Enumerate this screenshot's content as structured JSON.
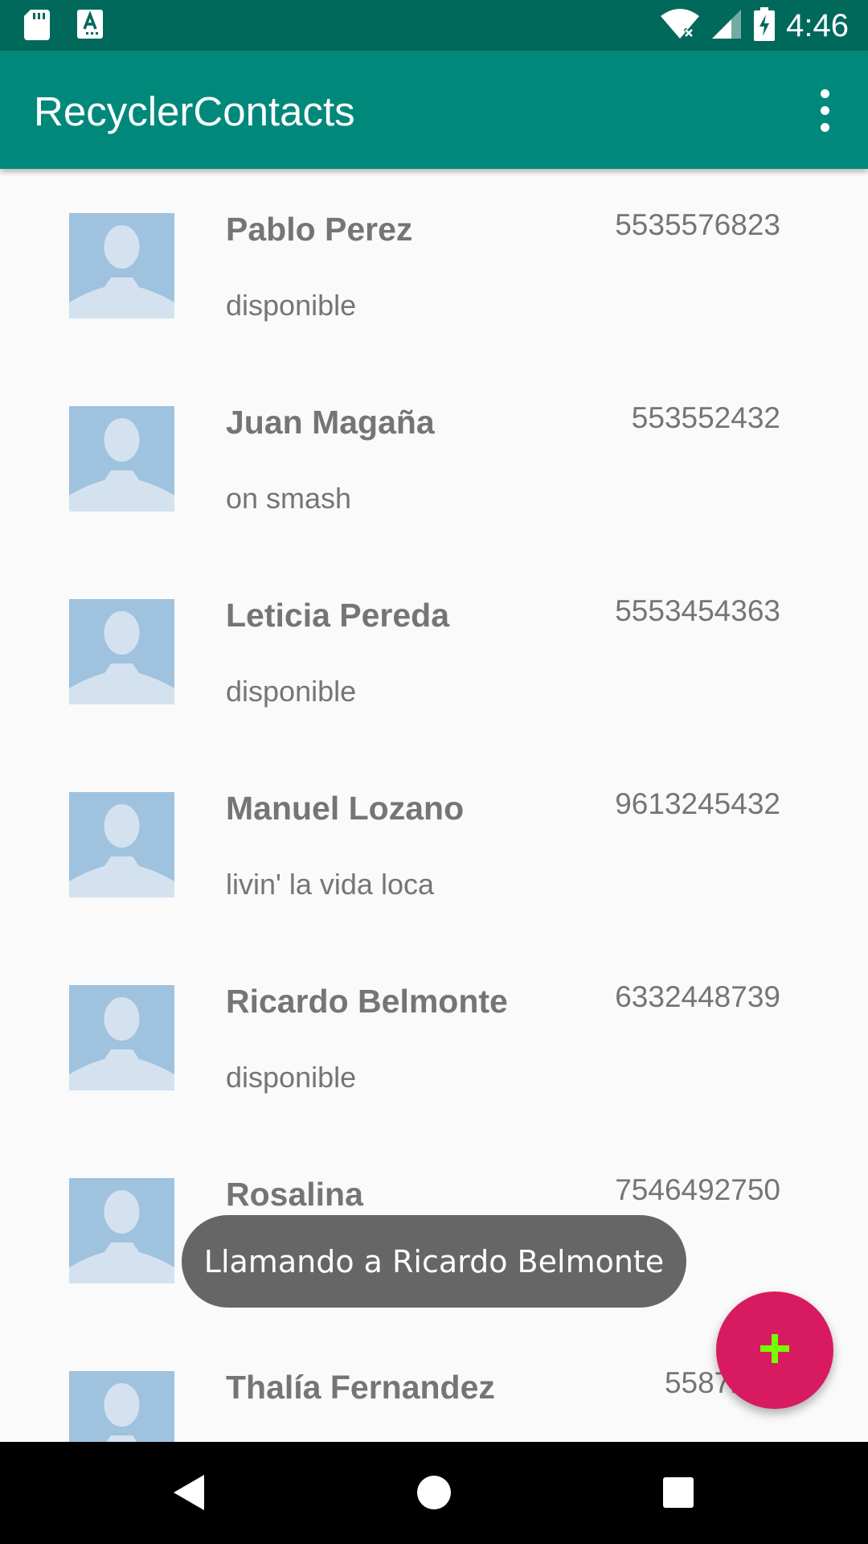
{
  "status_bar": {
    "time": "4:46",
    "icons_left": [
      "sd-card-icon",
      "text-a-icon"
    ],
    "icons_right": [
      "wifi-icon",
      "cell-signal-icon",
      "battery-charging-icon"
    ]
  },
  "app_bar": {
    "title": "RecyclerContacts",
    "menu_icon": "more-vert-icon",
    "color": "#00897b",
    "status_color": "#00695c"
  },
  "contacts": [
    {
      "name": "Pablo Perez",
      "status": "disponible",
      "phone": "5535576823"
    },
    {
      "name": "Juan Magaña",
      "status": "on smash",
      "phone": "553552432"
    },
    {
      "name": "Leticia Pereda",
      "status": "disponible",
      "phone": "5553454363"
    },
    {
      "name": "Manuel Lozano",
      "status": "livin' la vida loca",
      "phone": "9613245432"
    },
    {
      "name": "Ricardo Belmonte",
      "status": "disponible",
      "phone": "6332448739"
    },
    {
      "name": "Rosalina",
      "status": "",
      "phone": "7546492750"
    },
    {
      "name": "Thalía Fernandez",
      "status": "",
      "phone": "5587294"
    }
  ],
  "toast": {
    "message": "Llamando a Ricardo Belmonte"
  },
  "fab": {
    "icon": "plus-icon",
    "color": "#d81b60",
    "icon_color": "#76ff03"
  },
  "nav_bar": {
    "back_icon": "back-icon",
    "home_icon": "home-icon",
    "recents_icon": "recents-icon"
  }
}
